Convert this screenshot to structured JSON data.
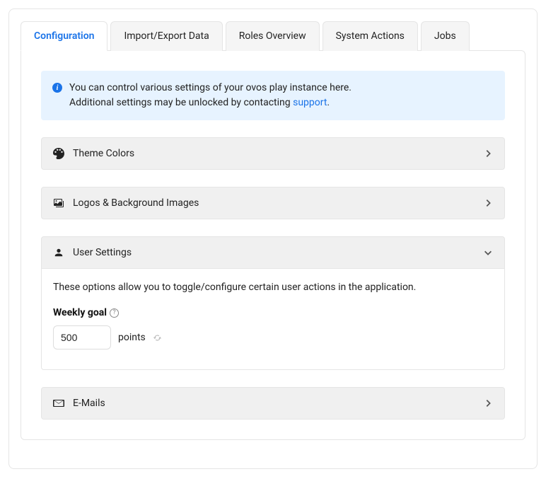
{
  "tabs": {
    "configuration": "Configuration",
    "import_export": "Import/Export Data",
    "roles": "Roles Overview",
    "system_actions": "System Actions",
    "jobs": "Jobs"
  },
  "info": {
    "line1": "You can control various settings of your ovos play instance here.",
    "line2_prefix": "Additional settings may be unlocked by contacting ",
    "support_link": "support",
    "line2_suffix": "."
  },
  "sections": {
    "theme_colors": {
      "title": "Theme Colors"
    },
    "logos": {
      "title": "Logos & Background Images"
    },
    "user_settings": {
      "title": "User Settings",
      "description": "These options allow you to toggle/configure certain user actions in the application.",
      "weekly_goal_label": "Weekly goal",
      "weekly_goal_value": "500",
      "weekly_goal_unit": "points"
    },
    "emails": {
      "title": "E-Mails"
    }
  }
}
